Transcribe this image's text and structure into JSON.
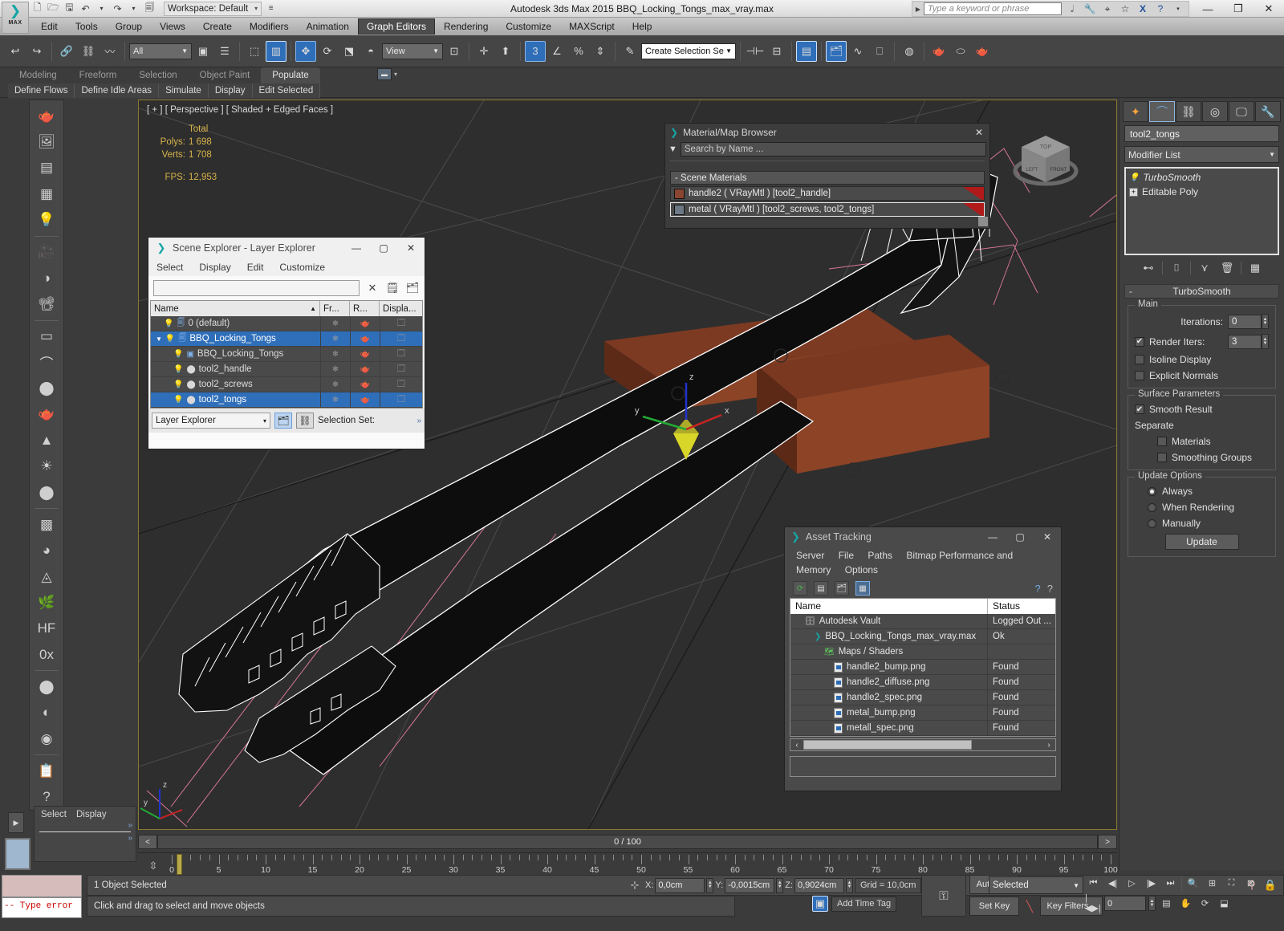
{
  "titlebar": {
    "app_title": "Autodesk 3ds Max  2015     BBQ_Locking_Tongs_max_vray.max",
    "workspace": "Workspace: Default",
    "search_placeholder": "Type a keyword or phrase",
    "quick_access": [
      "new-icon",
      "open-icon",
      "save-icon",
      "undo-icon",
      "redo-icon",
      "setproject-icon"
    ],
    "help_icons": [
      "binoculars-icon",
      "wrench-icon",
      "satellite-icon",
      "star-icon",
      "exchange-icon",
      "help-icon"
    ],
    "window_buttons": [
      "minimize",
      "restore",
      "close"
    ],
    "logo_label": "MAX"
  },
  "menubar": {
    "items": [
      "Edit",
      "Tools",
      "Group",
      "Views",
      "Create",
      "Modifiers",
      "Animation",
      "Graph Editors",
      "Rendering",
      "Customize",
      "MAXScript",
      "Help"
    ],
    "active": "Graph Editors"
  },
  "toolbar": {
    "selection_filter": "All",
    "ref_coord_system": "View",
    "named_selection_set": "Create Selection Se",
    "snap_value": "3"
  },
  "ribbon": {
    "tabs": [
      "Modeling",
      "Freeform",
      "Selection",
      "Object Paint",
      "Populate"
    ],
    "active_tab": "Populate",
    "buttons": [
      "Define Flows",
      "Define Idle Areas",
      "Simulate",
      "Display",
      "Edit Selected"
    ]
  },
  "viewport": {
    "label": "[ + ] [ Perspective ] [ Shaded + Edged Faces ]",
    "stats_header": "Total",
    "polys_label": "Polys:",
    "polys_value": "1 698",
    "verts_label": "Verts:",
    "verts_value": "1 708",
    "fps_label": "FPS:",
    "fps_value": "12,953",
    "viewcube_faces": [
      "TOP",
      "LEFT",
      "FRONT"
    ],
    "axis_labels": [
      "x",
      "y",
      "z"
    ]
  },
  "timeslider": {
    "prev": "<",
    "value": "0 / 100",
    "next": ">"
  },
  "trackbar": {
    "ticks": [
      "0",
      "5",
      "10",
      "15",
      "20",
      "25",
      "30",
      "35",
      "40",
      "45",
      "50",
      "55",
      "60",
      "65",
      "70",
      "75",
      "80",
      "85",
      "90",
      "95",
      "100"
    ]
  },
  "select_display_panel": {
    "items": [
      "Select",
      "Display"
    ],
    "chevron": "»"
  },
  "statusbar": {
    "maxscript_error": "-- Type error",
    "object_status": "1 Object Selected",
    "prompt": "Click and drag to select and move objects",
    "coords": [
      {
        "axis": "X:",
        "value": "0,0cm"
      },
      {
        "axis": "Y:",
        "value": "-0,0015cm"
      },
      {
        "axis": "Z:",
        "value": "0,9024cm"
      }
    ],
    "grid": "Grid = 10,0cm",
    "add_time_tag": "Add Time Tag",
    "auto_key": "Auto Key",
    "set_key": "Set Key",
    "key_filters": "Key Filters...",
    "key_mode_selected": "Selected",
    "spinner_value": "0"
  },
  "command_panel": {
    "tabs": [
      "create-tab",
      "modify-tab",
      "hierarchy-tab",
      "motion-tab",
      "display-tab",
      "utilities-tab"
    ],
    "active_tab_index": 1,
    "object_name": "tool2_tongs",
    "modifier_list_label": "Modifier List",
    "stack": [
      {
        "label": "TurboSmooth",
        "italic": true,
        "icon": "lightbulb-icon"
      },
      {
        "label": "Editable Poly",
        "italic": false,
        "icon": "plus-icon"
      }
    ],
    "rollout": {
      "title": "TurboSmooth",
      "main_group": "Main",
      "iterations_label": "Iterations:",
      "iterations_value": "0",
      "render_iters_label": "Render Iters:",
      "render_iters_value": "3",
      "render_iters_checked": true,
      "isoline_label": "Isoline Display",
      "isoline_checked": false,
      "explicit_normals_label": "Explicit Normals",
      "explicit_normals_checked": false,
      "surface_group": "Surface Parameters",
      "smooth_result_label": "Smooth Result",
      "smooth_result_checked": true,
      "separate_label": "Separate",
      "materials_label": "Materials",
      "materials_checked": false,
      "smoothing_groups_label": "Smoothing Groups",
      "smoothing_groups_checked": false,
      "update_group": "Update Options",
      "update_options": [
        "Always",
        "When Rendering",
        "Manually"
      ],
      "update_selected": "Always",
      "update_button": "Update"
    }
  },
  "scene_explorer": {
    "title": "Scene Explorer - Layer Explorer",
    "menu": [
      "Select",
      "Display",
      "Edit",
      "Customize"
    ],
    "search_value": "",
    "columns": [
      "Name",
      "Fr...",
      "R...",
      "Displa..."
    ],
    "rows": [
      {
        "name": "0 (default)",
        "indent": 1,
        "icon": "layer-icon",
        "selected": false,
        "expander": ""
      },
      {
        "name": "BBQ_Locking_Tongs",
        "indent": 1,
        "icon": "layer-icon",
        "selected": true,
        "expander": "▼"
      },
      {
        "name": "BBQ_Locking_Tongs",
        "indent": 2,
        "icon": "group-icon",
        "selected": false,
        "expander": ""
      },
      {
        "name": "tool2_handle",
        "indent": 2,
        "icon": "object-icon",
        "selected": false,
        "expander": ""
      },
      {
        "name": "tool2_screws",
        "indent": 2,
        "icon": "object-icon",
        "selected": false,
        "expander": ""
      },
      {
        "name": "tool2_tongs",
        "indent": 2,
        "icon": "object-icon",
        "selected": true,
        "expander": ""
      }
    ],
    "footer_combo": "Layer Explorer",
    "footer_label": "Selection Set:"
  },
  "material_browser": {
    "title": "Material/Map Browser",
    "search_placeholder": "Search by Name ...",
    "section": "- Scene Materials",
    "items": [
      {
        "label": "handle2  ( VRayMtl )  [tool2_handle]",
        "swatch": "#8a4630",
        "selected": false
      },
      {
        "label": "metal  ( VRayMtl )  [tool2_screws, tool2_tongs]",
        "swatch": "#6d7a86",
        "selected": true
      }
    ]
  },
  "asset_tracking": {
    "title": "Asset Tracking",
    "menu": [
      "Server",
      "File",
      "Paths",
      "Bitmap Performance and Memory",
      "Options"
    ],
    "columns": [
      "Name",
      "Status"
    ],
    "rows": [
      {
        "name": "Autodesk Vault",
        "status": "Logged Out ...",
        "indent": 1,
        "icon": "vault-icon"
      },
      {
        "name": "BBQ_Locking_Tongs_max_vray.max",
        "status": "Ok",
        "indent": 2,
        "icon": "max-icon"
      },
      {
        "name": "Maps / Shaders",
        "status": "",
        "indent": 3,
        "icon": "maps-icon"
      },
      {
        "name": "handle2_bump.png",
        "status": "Found",
        "indent": 4,
        "icon": "bitmap-icon"
      },
      {
        "name": "handle2_diffuse.png",
        "status": "Found",
        "indent": 4,
        "icon": "bitmap-icon"
      },
      {
        "name": "handle2_spec.png",
        "status": "Found",
        "indent": 4,
        "icon": "bitmap-icon"
      },
      {
        "name": "metal_bump.png",
        "status": "Found",
        "indent": 4,
        "icon": "bitmap-icon"
      },
      {
        "name": "metall_spec.png",
        "status": "Found",
        "indent": 4,
        "icon": "bitmap-icon"
      }
    ]
  },
  "colors": {
    "accent_blue": "#2f6fba",
    "viewport_bg": "#2e2e2e",
    "viewport_border": "#8a7a30",
    "stat_yellow": "#d7b34a",
    "wood": "#8a3c22",
    "error_red": "#cc0000"
  }
}
